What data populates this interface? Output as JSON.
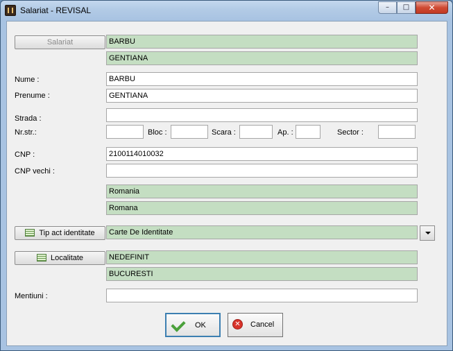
{
  "window": {
    "title": "Salariat - REVISAL",
    "controls": {
      "minimize": "–",
      "maximize": "□",
      "close": "✕"
    }
  },
  "salariat": {
    "button_label": "Salariat",
    "nume_display": "BARBU",
    "prenume_display": "GENTIANA"
  },
  "form": {
    "nume_label": "Nume :",
    "nume_value": "BARBU",
    "prenume_label": "Prenume :",
    "prenume_value": "GENTIANA",
    "strada_label": "Strada :",
    "strada_value": "",
    "nrstr_label": "Nr.str.:",
    "nrstr_value": "",
    "bloc_label": "Bloc :",
    "bloc_value": "",
    "scara_label": "Scara :",
    "scara_value": "",
    "ap_label": "Ap. :",
    "ap_value": "",
    "sector_label": "Sector :",
    "sector_value": "",
    "cnp_label": "CNP :",
    "cnp_value": "2100114010032",
    "cnp_vechi_label": "CNP vechi :",
    "cnp_vechi_value": "",
    "tara": "Romania",
    "nationalitate": "Romana",
    "tip_act_button": "Tip act identitate",
    "tip_act_value": "Carte De Identitate",
    "localitate_button": "Localitate",
    "localitate_value": "NEDEFINIT",
    "judet_value": "BUCURESTI",
    "mentiuni_label": "Mentiuni :",
    "mentiuni_value": ""
  },
  "actions": {
    "ok_label": "OK",
    "cancel_label": "Cancel"
  },
  "colors": {
    "readonly_field": "#c4dec2",
    "ok_border": "#3c7fb1",
    "close_button": "#c23a24"
  },
  "icons": {
    "app": "revisal-app-icon",
    "list": "list-icon",
    "ok": "check-icon",
    "cancel": "cancel-icon",
    "dropdown": "chevron-down-icon"
  }
}
